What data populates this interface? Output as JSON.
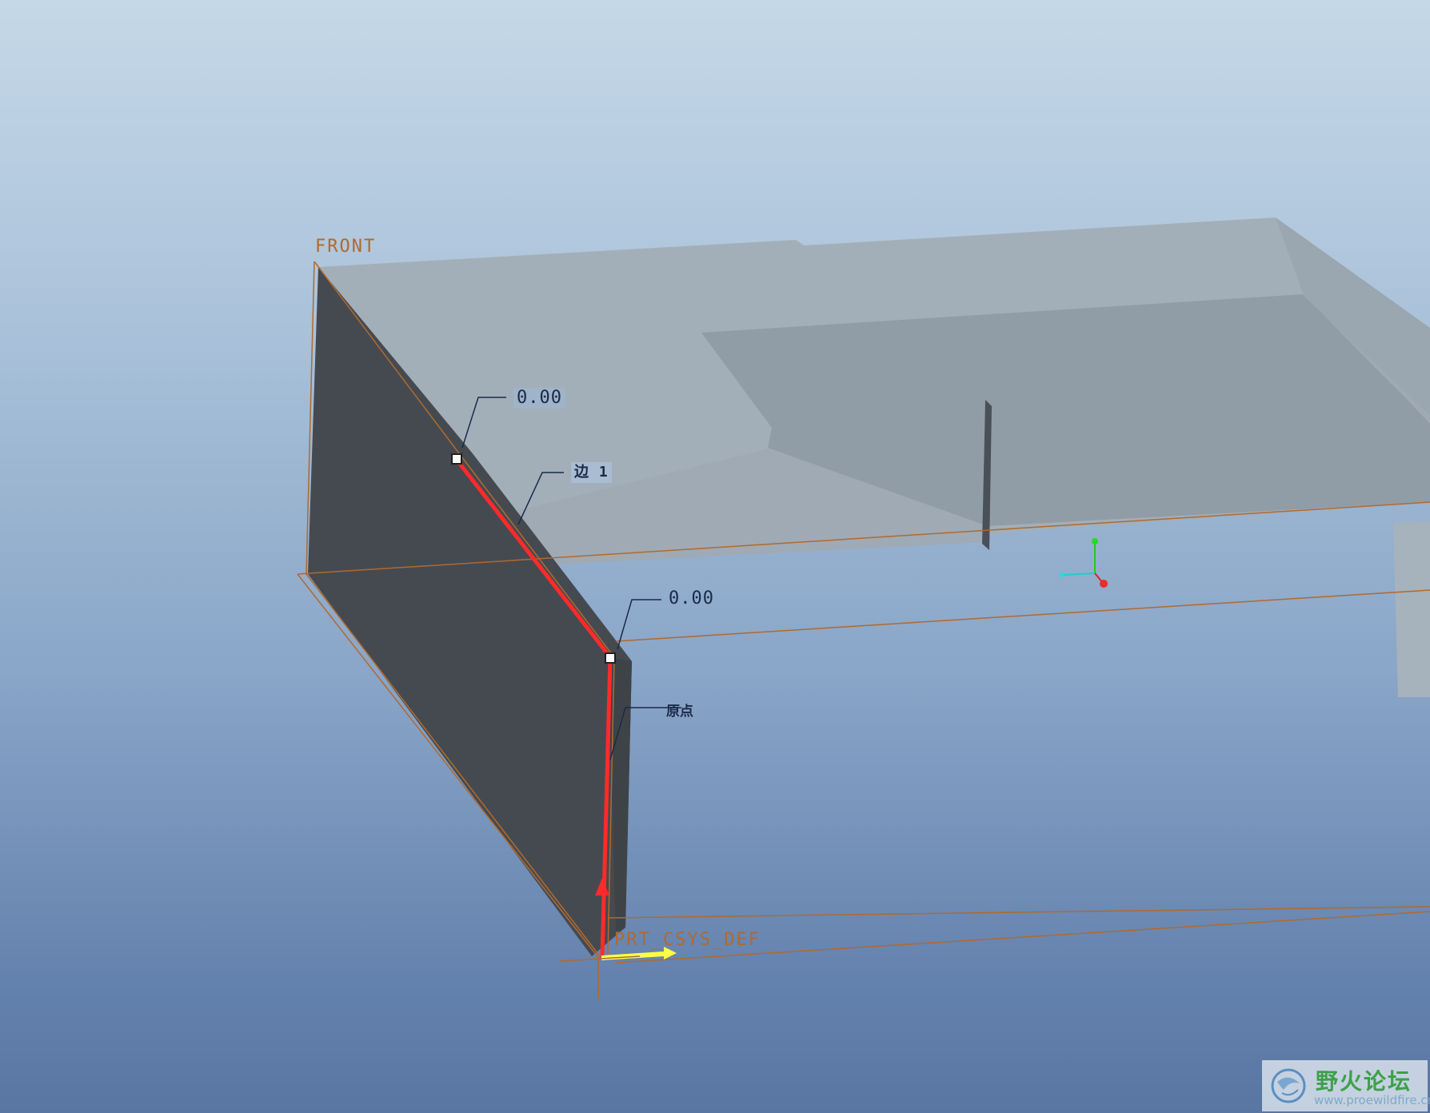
{
  "viewport": {
    "labels": {
      "front_plane": "FRONT",
      "csys": "PRT_CSYS_DEF"
    },
    "dimensions": {
      "top_point_offset": "0.00",
      "bottom_point_offset": "0.00",
      "edge_reference": "边 1",
      "origin_reference": "原点"
    },
    "colors": {
      "datum_plane": "#b06a2e",
      "selected_edge": "#ff2a2a",
      "part_surface": "#a3afb8",
      "dark_face": "#454a50",
      "csys_arrow": "#ffff44"
    },
    "icons": [
      "view-triad-icon",
      "csys-arrow-icon",
      "drag-handle-icon"
    ]
  },
  "watermark": {
    "title": "野火论坛",
    "url": "www.proewildfire.cn"
  }
}
